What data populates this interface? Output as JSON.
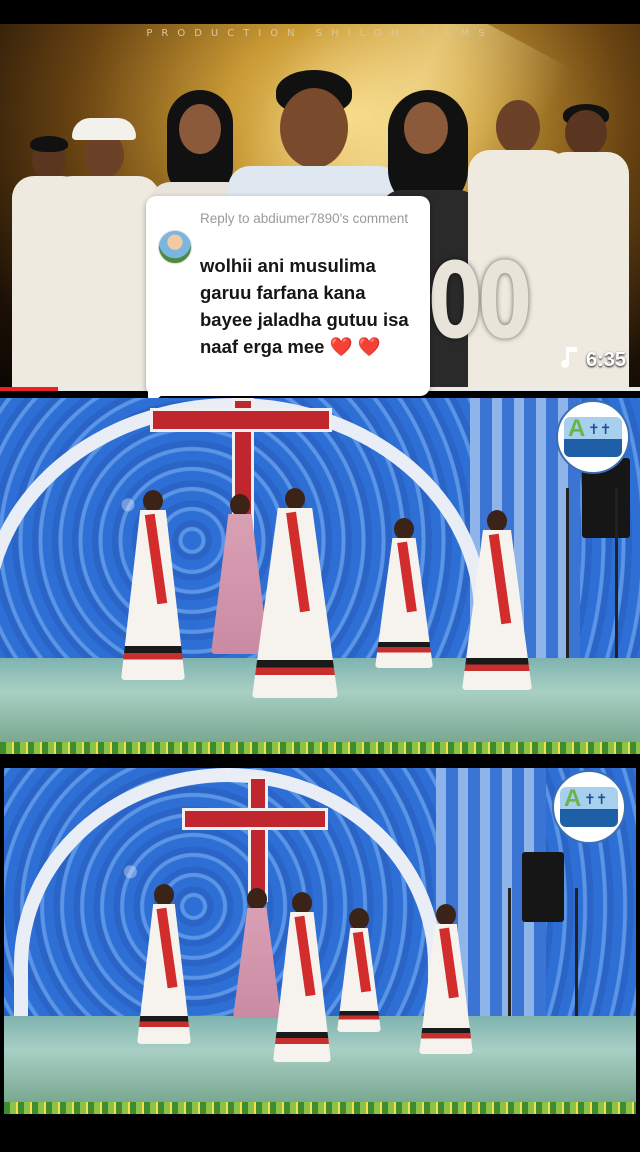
{
  "banner": {
    "production_text": "PRODUCTION SHILOH FILMS",
    "big_numerals": "00",
    "duration": "6:35",
    "progress_percent": 9,
    "music_icon": "music-note-icon"
  },
  "comment": {
    "reply_meta": "Reply to abdiumer7890's comment",
    "text": "wolhii ani musulima garuu farfana kana bayee jaladha gutuu isa naaf erga mee",
    "hearts": "❤️ ❤️"
  },
  "colors": {
    "progress_fill": "#e8202a",
    "heart": "#e22d33",
    "wall_blue": "#2e6fd6"
  }
}
